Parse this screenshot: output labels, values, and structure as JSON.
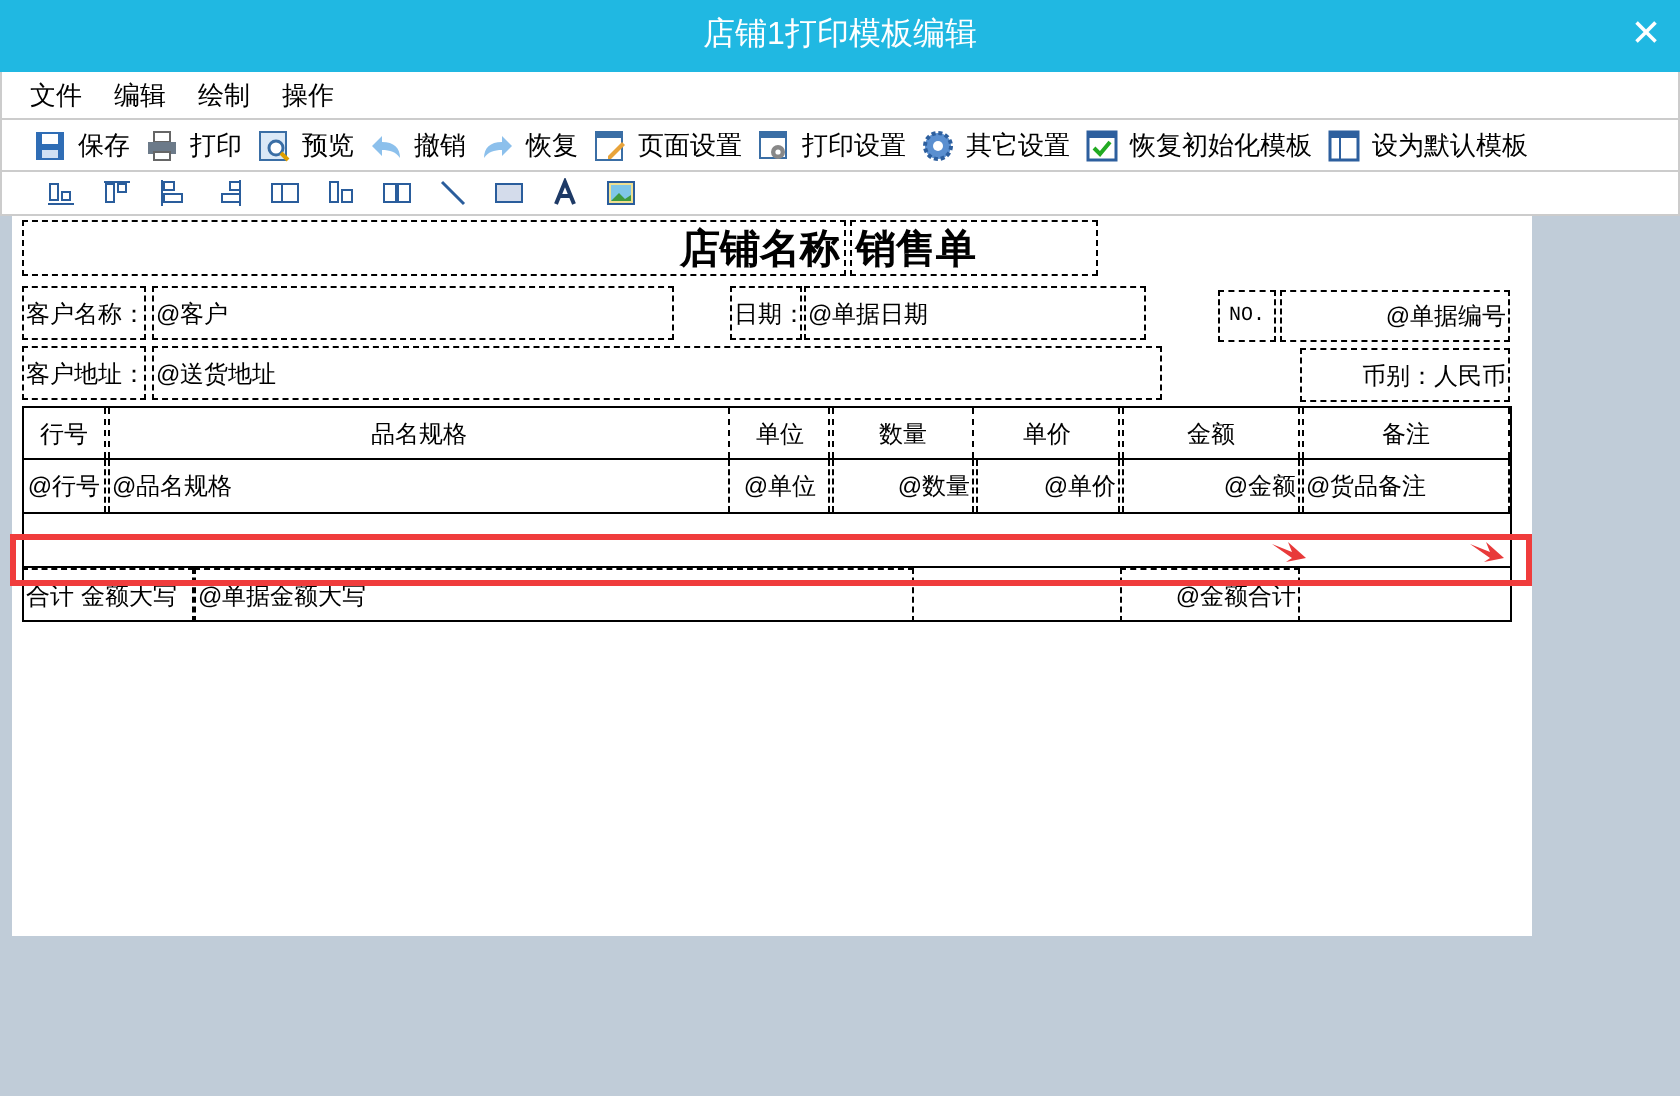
{
  "window": {
    "title": "店铺1打印模板编辑",
    "close": "×"
  },
  "menu": [
    "文件",
    "编辑",
    "绘制",
    "操作"
  ],
  "toolbar": [
    {
      "kind": "save",
      "label": "保存"
    },
    {
      "kind": "print",
      "label": "打印"
    },
    {
      "kind": "preview",
      "label": "预览"
    },
    {
      "kind": "undo",
      "label": "撤销"
    },
    {
      "kind": "redo",
      "label": "恢复"
    },
    {
      "kind": "page",
      "label": "页面设置"
    },
    {
      "kind": "printset",
      "label": "打印设置"
    },
    {
      "kind": "gear",
      "label": "其它设置"
    },
    {
      "kind": "reset",
      "label": "恢复初始化模板"
    },
    {
      "kind": "default",
      "label": "设为默认模板"
    }
  ],
  "template": {
    "store_name": "店铺名称",
    "doc_type": "销售单",
    "customer_label": "客户名称：",
    "customer_value": "@客户",
    "date_label": "日期：",
    "date_value": "@单据日期",
    "no_label": "NO.",
    "no_value": "@单据编号",
    "address_label": "客户地址：",
    "address_value": "@送货地址",
    "currency": "币别：人民币",
    "columns": [
      "行号",
      "品名规格",
      "单位",
      "数量",
      "单价",
      "金额",
      "备注"
    ],
    "row": [
      "@行号",
      "@品名规格",
      "@单位",
      "@数量",
      "@单价",
      "@金额",
      "@货品备注"
    ],
    "total_label": "合计 金额大写",
    "total_words": "@单据金额大写",
    "total_sum": "@金额合计"
  }
}
